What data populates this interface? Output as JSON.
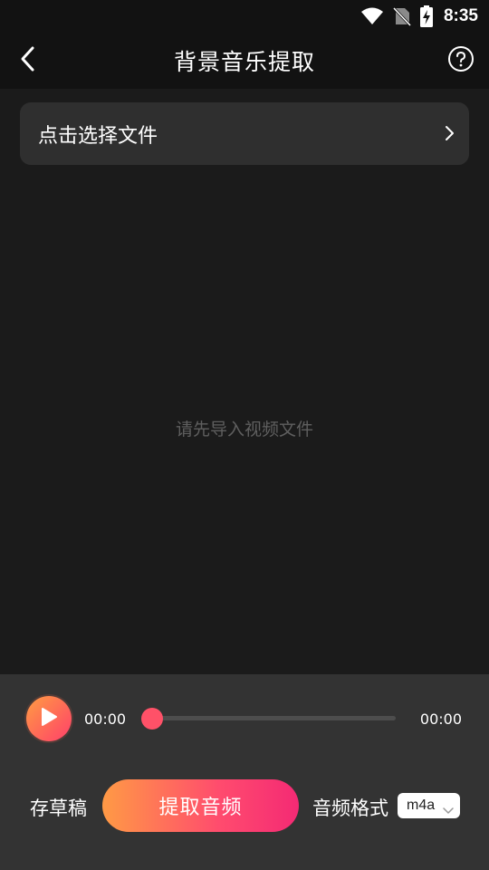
{
  "status_bar": {
    "time": "8:35",
    "icons": [
      "wifi-icon",
      "no-sim-icon",
      "battery-charging-icon"
    ]
  },
  "header": {
    "title": "背景音乐提取",
    "back_icon": "back-arrow-icon",
    "help_icon": "help-circle-icon"
  },
  "file_select": {
    "label": "点击选择文件",
    "icon": "chevron-right-icon"
  },
  "preview": {
    "empty_hint": "请先导入视频文件"
  },
  "player": {
    "play_icon": "play-icon",
    "current_time": "00:00",
    "total_time": "00:00",
    "progress": 0
  },
  "actions": {
    "draft_label": "存草稿",
    "extract_label": "提取音频",
    "format_label": "音频格式",
    "format_value": "m4a"
  },
  "colors": {
    "background": "#1b1b1b",
    "header": "#121212",
    "panel": "#333333",
    "accent_start": "#ff9a45",
    "accent_end": "#f42a74"
  }
}
